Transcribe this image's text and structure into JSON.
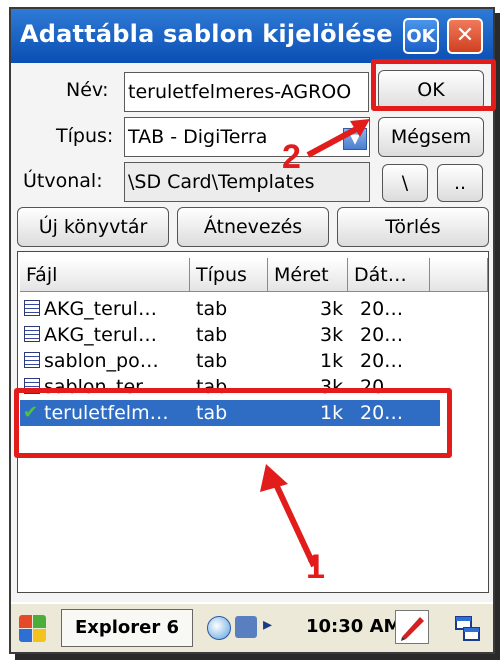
{
  "dialog": {
    "title": "Adattábla sablon kijelölése",
    "title_ok": "OK",
    "title_close": "✕"
  },
  "form": {
    "name_label": "Név:",
    "name_value": "teruletfelmeres-AGROO",
    "type_label": "Típus:",
    "type_value": "TAB - DigiTerra",
    "path_label": "Útvonal:",
    "path_value": "\\SD Card\\Templates",
    "ok_label": "OK",
    "cancel_label": "Mégsem",
    "root_label": "\\",
    "up_label": ".."
  },
  "actions": {
    "new_folder": "Új könyvtár",
    "rename": "Átnevezés",
    "delete": "Törlés"
  },
  "file_list": {
    "columns": [
      "Fájl",
      "Típus",
      "Méret",
      "Dát…"
    ],
    "rows": [
      {
        "name": "AKG_terul…",
        "type": "tab",
        "size": "3k",
        "date": "20…"
      },
      {
        "name": "AKG_terul…",
        "type": "tab",
        "size": "3k",
        "date": "20…"
      },
      {
        "name": "sablon_po…",
        "type": "tab",
        "size": "1k",
        "date": "20…"
      },
      {
        "name": "sablon_ter…",
        "type": "tab",
        "size": "3k",
        "date": "20…"
      },
      {
        "name": "teruletfelm…",
        "type": "tab",
        "size": "1k",
        "date": "20…"
      }
    ],
    "selected_index": 4
  },
  "taskbar": {
    "app_label": "Explorer 6",
    "time": "10:30 AM"
  },
  "annotations": {
    "label_1": "1",
    "label_2": "2",
    "color": "#e21b1b"
  }
}
